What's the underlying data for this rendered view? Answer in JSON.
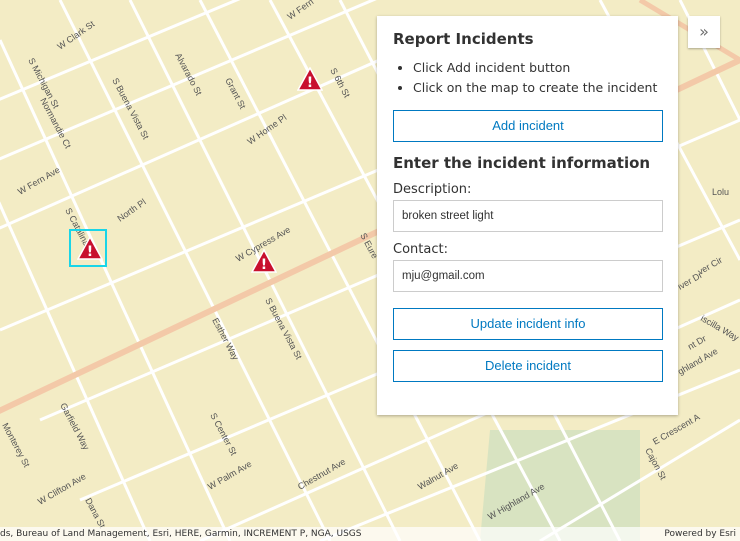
{
  "panel": {
    "title": "Report Incidents",
    "instructions": [
      "Click Add incident button",
      "Click on the map to create the incident"
    ],
    "add_button": "Add incident",
    "info_title": "Enter the incident information",
    "description_label": "Description:",
    "description_value": "broken street light",
    "contact_label": "Contact:",
    "contact_value": "mju@gmail.com",
    "update_button": "Update incident info",
    "delete_button": "Delete incident"
  },
  "map": {
    "streets": [
      "W Clark St",
      "S Michigan St",
      "Normandie Ct",
      "S Buena Vista St",
      "Alvarado St",
      "Grant St",
      "W Home Pl",
      "S 6th St",
      "W Fern",
      "W Fern Ave",
      "S Catalina St",
      "North Pl",
      "W Cypress Ave",
      "S Eure",
      "Esther Way",
      "S Buena Vista St",
      "Garfield Way",
      "Monterey St",
      "W Clifton Ave",
      "Dana St",
      "S Center St",
      "W Palm Ave",
      "Chestnut Ave",
      "Walnut Ave",
      "W Highland Ave",
      "E Crescent A",
      "Cajon St",
      "Lolu",
      "iver Dr",
      "iscilla Way",
      "ver Cir",
      "ghland Ave",
      "nt Dr"
    ],
    "colors": {
      "land": "#f3ecc5",
      "road": "#ffffff",
      "major_road": "#f3c9a8",
      "park": "#d8e3c1",
      "marker": "#c8102e",
      "highlight": "#19d5e8"
    },
    "markers": [
      "incident-marker",
      "incident-marker",
      "incident-marker"
    ]
  },
  "attribution": {
    "left": "ds, Bureau of Land Management, Esri, HERE, Garmin, INCREMENT P, NGA, USGS",
    "right": "Powered by Esri"
  },
  "expand_icon": "double-chevron-right-icon"
}
